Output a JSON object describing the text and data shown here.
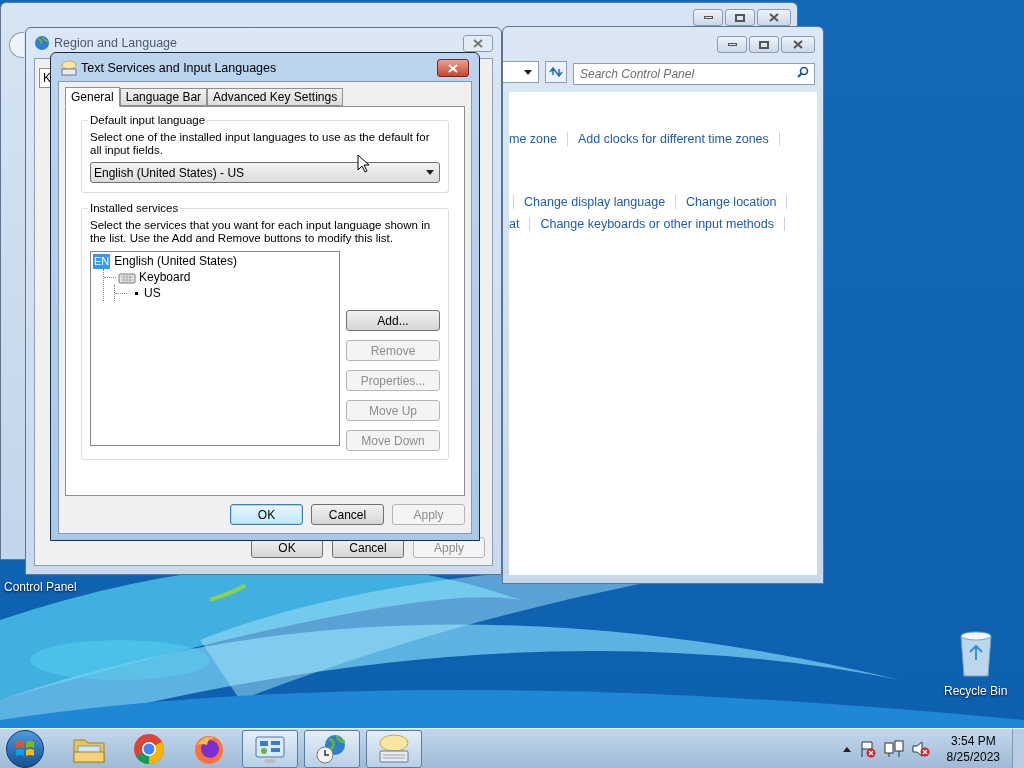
{
  "desktop": {
    "icons": [
      {
        "kind": "control_panel",
        "label": "Control Panel"
      },
      {
        "kind": "recycle_bin",
        "label": "Recycle Bin"
      }
    ]
  },
  "control_panel": {
    "search": {
      "placeholder": "Search Control Panel"
    },
    "link_rows": [
      [
        "me zone",
        "Add clocks for different time zones"
      ],
      [
        "Change display language",
        "Change location"
      ],
      [
        "at",
        "Change keyboards or other input methods"
      ]
    ]
  },
  "region_window": {
    "title": "Region and Language",
    "tab_fragment": "K",
    "buttons": [
      {
        "label": "OK",
        "disabled": false
      },
      {
        "label": "Cancel",
        "disabled": false
      },
      {
        "label": "Apply",
        "disabled": true
      }
    ]
  },
  "dialog": {
    "title": "Text Services and Input Languages",
    "tabs": [
      {
        "label": "General",
        "selected": true
      },
      {
        "label": "Language Bar",
        "selected": false
      },
      {
        "label": "Advanced Key Settings",
        "selected": false
      }
    ],
    "default_language": {
      "heading": "Default input language",
      "description": "Select one of the installed input languages to use as the default for all input fields.",
      "value": "English (United States) - US"
    },
    "installed_services": {
      "heading": "Installed services",
      "description": "Select the services that you want for each input language shown in the list. Use the Add and Remove buttons to modify this list.",
      "tree": [
        {
          "kind": "language",
          "badge": "EN",
          "label": "English (United States)",
          "children": [
            {
              "kind": "category",
              "label": "Keyboard",
              "children": [
                {
                  "kind": "service",
                  "label": "US"
                }
              ]
            }
          ]
        }
      ],
      "buttons": [
        {
          "label": "Add...",
          "disabled": false
        },
        {
          "label": "Remove",
          "disabled": true
        },
        {
          "label": "Properties...",
          "disabled": true
        },
        {
          "label": "Move Up",
          "disabled": true
        },
        {
          "label": "Move Down",
          "disabled": true
        }
      ]
    },
    "buttons": [
      {
        "label": "OK",
        "disabled": false,
        "default": true
      },
      {
        "label": "Cancel",
        "disabled": false,
        "default": false
      },
      {
        "label": "Apply",
        "disabled": true,
        "default": false
      }
    ]
  },
  "taskbar": {
    "apps": [
      {
        "kind": "explorer",
        "open": false
      },
      {
        "kind": "chrome",
        "open": false
      },
      {
        "kind": "firefox",
        "open": false
      },
      {
        "kind": "control_panel",
        "open": true
      },
      {
        "kind": "region",
        "open": true
      },
      {
        "kind": "keyboard",
        "open": true
      }
    ],
    "tray": [
      {
        "kind": "chevron"
      },
      {
        "kind": "action_center"
      },
      {
        "kind": "network"
      },
      {
        "kind": "speaker"
      }
    ],
    "time": "3:54 PM",
    "date": "8/25/2023"
  }
}
